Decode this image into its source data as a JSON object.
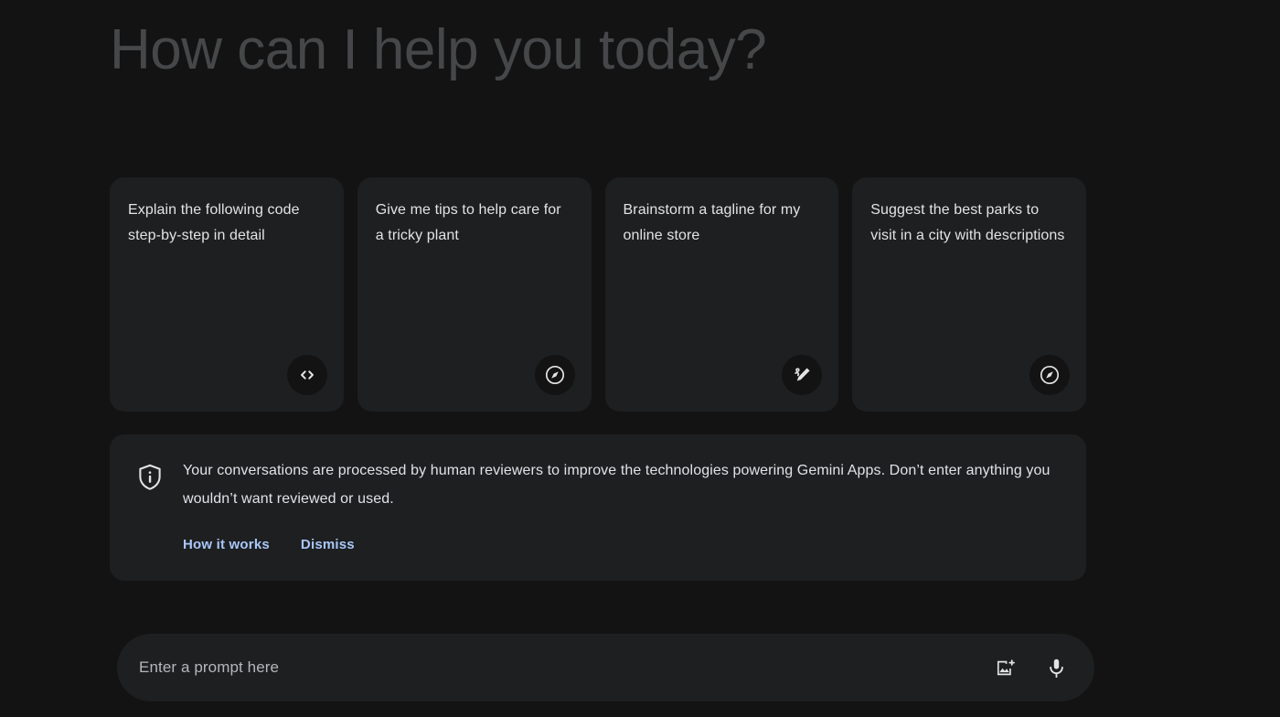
{
  "colors": {
    "page_background": "#131314",
    "surface": "#1e1f20",
    "greeting_text": "#454749",
    "card_text": "#e3e3e3",
    "link_blue": "#a8c7fa",
    "sparkle_magenta": "#c77dd8",
    "icon_white": "#e3e3e3",
    "placeholder": "#b4b7ba"
  },
  "greeting": {
    "title": "How can I help you today?",
    "sparkle_icon": "gemini-sparkle-icon"
  },
  "suggestion_cards": [
    {
      "text": "Explain the following code step-by-step in detail",
      "icon": "code-icon"
    },
    {
      "text": "Give me tips to help care for a tricky plant",
      "icon": "explore-compass-icon"
    },
    {
      "text": "Brainstorm a tagline for my online store",
      "icon": "draw-pencil-icon"
    },
    {
      "text": "Suggest the best parks to visit in a city with descriptions",
      "icon": "explore-compass-icon"
    }
  ],
  "notice": {
    "icon": "privacy-shield-info-icon",
    "text": "Your conversations are processed by human reviewers to improve the technologies powering Gemini Apps. Don’t enter anything you wouldn’t want reviewed or used.",
    "how_it_works_label": "How it works",
    "dismiss_label": "Dismiss"
  },
  "prompt": {
    "placeholder": "Enter a prompt here",
    "value": "",
    "add_image_icon": "add-image-icon",
    "microphone_icon": "microphone-icon"
  }
}
